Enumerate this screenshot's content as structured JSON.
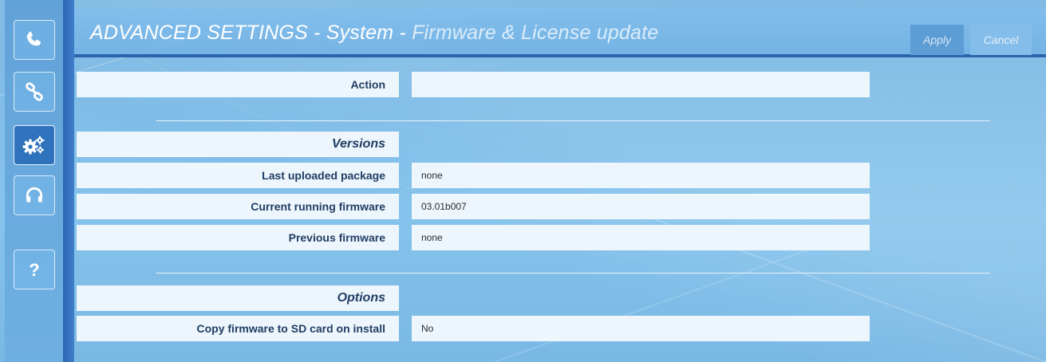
{
  "sidebar": {
    "items": [
      {
        "name": "phone-icon",
        "active": false
      },
      {
        "name": "link-icon",
        "active": false
      },
      {
        "name": "gears-icon",
        "active": true
      },
      {
        "name": "headset-icon",
        "active": false
      },
      {
        "name": "help-icon",
        "active": false
      }
    ]
  },
  "header": {
    "title_main": "ADVANCED SETTINGS - System - ",
    "title_sub": "Firmware & License update",
    "apply_label": "Apply",
    "cancel_label": "Cancel"
  },
  "action": {
    "label": "Action",
    "value": ""
  },
  "versions": {
    "heading": "Versions",
    "rows": [
      {
        "label": "Last uploaded package",
        "value": "none"
      },
      {
        "label": "Current running firmware",
        "value": "03.01b007"
      },
      {
        "label": "Previous firmware",
        "value": "none"
      }
    ]
  },
  "options": {
    "heading": "Options",
    "rows": [
      {
        "label": "Copy firmware to SD card on install",
        "value": "No"
      }
    ]
  },
  "colors": {
    "accent": "#2d63ad",
    "active_nav": "#2f73bd",
    "cell_bg": "#eef6fd",
    "label_text": "#1f3d63"
  }
}
